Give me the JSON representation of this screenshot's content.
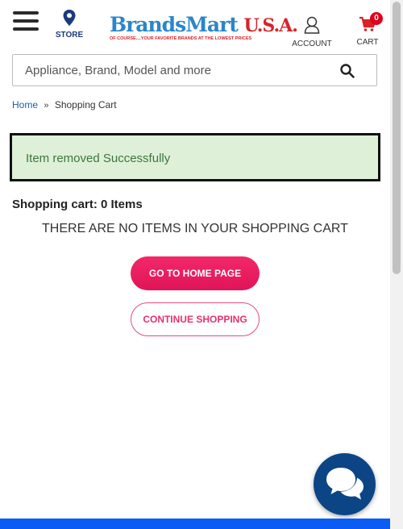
{
  "header": {
    "store_label": "STORE",
    "logo": {
      "brand": "BrandsMart",
      "usa": "U.S.A.",
      "tagline": "OF COURSE....YOUR FAVORITE BRANDS AT THE LOWEST PRICES"
    },
    "account_label": "ACCOUNT",
    "cart_label": "CART",
    "cart_count": "0"
  },
  "search": {
    "placeholder": "Appliance, Brand, Model and more",
    "value": ""
  },
  "breadcrumb": {
    "home": "Home",
    "separator": "»",
    "current": "Shopping Cart"
  },
  "alert": {
    "message": "Item removed Successfully"
  },
  "cart": {
    "title": "Shopping cart: 0 Items",
    "empty_message": "THERE ARE NO ITEMS IN YOUR SHOPPING CART",
    "home_button": "GO TO HOME PAGE",
    "continue_button": "CONTINUE SHOPPING"
  },
  "colors": {
    "accent_pink": "#e8185f",
    "brand_blue": "#2a86c8",
    "brand_red": "#d8232a",
    "alert_bg": "#dff0d8",
    "alert_text": "#3c763d",
    "chat_bg": "#0b4585"
  },
  "icons": [
    "menu-icon",
    "location-pin-icon",
    "user-icon",
    "cart-icon",
    "search-icon",
    "chat-icon"
  ]
}
